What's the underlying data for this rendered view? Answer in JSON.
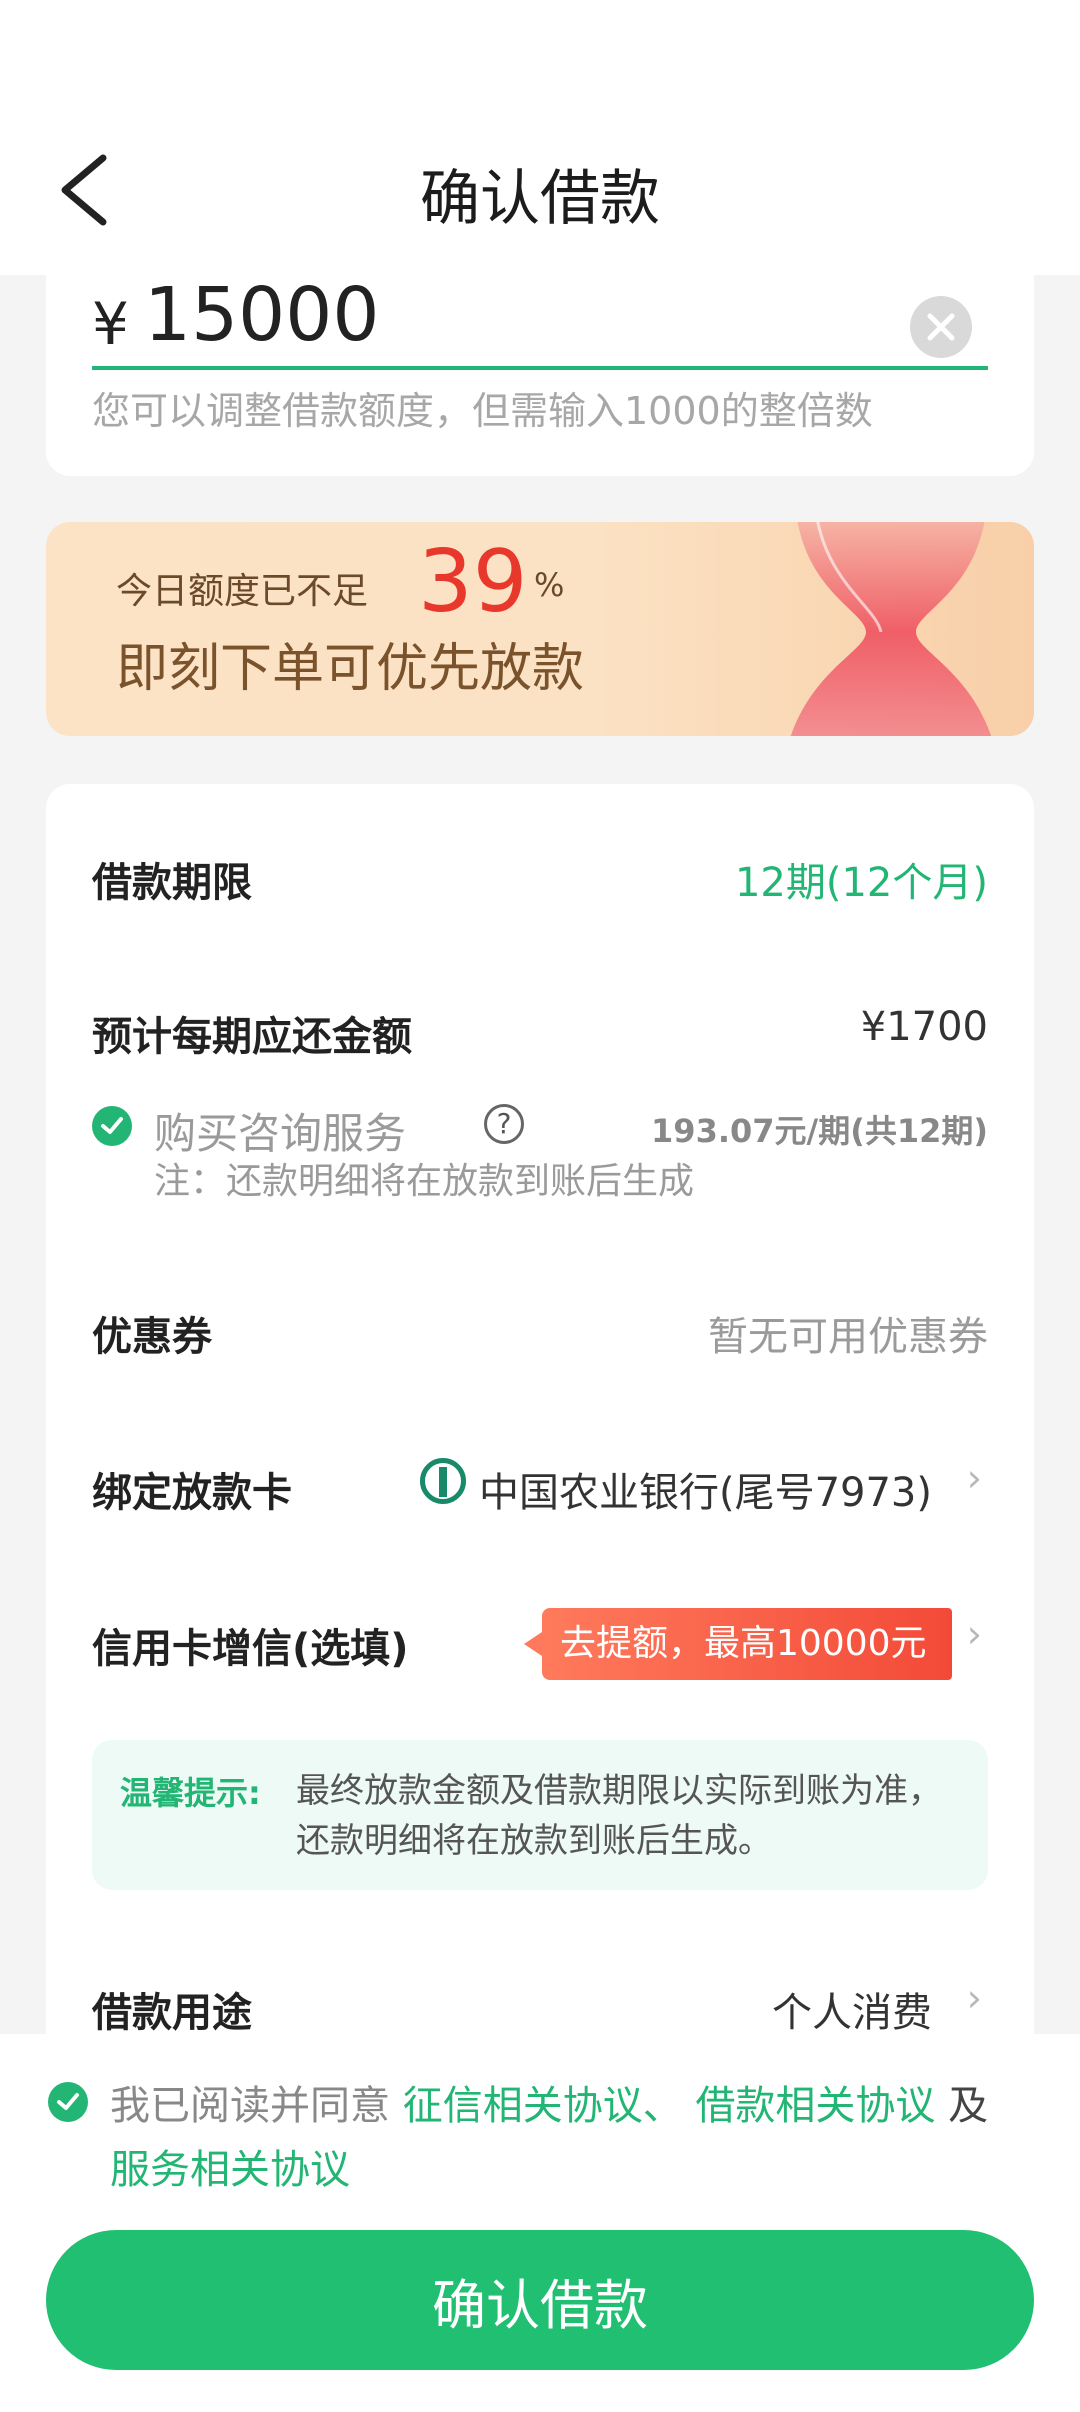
{
  "header": {
    "title": "确认借款"
  },
  "amount": {
    "currency": "¥",
    "value": "15000",
    "hint": "您可以调整借款额度，但需输入1000的整倍数"
  },
  "banner": {
    "line1": "今日额度已不足",
    "number": "39",
    "unit": "%",
    "line2": "即刻下单可优先放款"
  },
  "term": {
    "label": "借款期限",
    "value": "12期(12个月)"
  },
  "repayment": {
    "label": "预计每期应还金额",
    "value": "¥1700"
  },
  "service": {
    "label": "购买咨询服务",
    "help": "?",
    "price": "193.07元/期(共12期)",
    "note": "注：还款明细将在放款到账后生成"
  },
  "coupon": {
    "label": "优惠券",
    "value": "暂无可用优惠券"
  },
  "card": {
    "label": "绑定放款卡",
    "value": "中国农业银行(尾号7973)"
  },
  "credit_boost": {
    "label": "信用卡增信(选填)",
    "badge": "去提额，最高10000元"
  },
  "tip": {
    "label": "温馨提示:",
    "text": "最终放款金额及借款期限以实际到账为准，还款明细将在放款到账后生成。"
  },
  "purpose": {
    "label": "借款用途",
    "value": "个人消费"
  },
  "agreement": {
    "prefix": "我已阅读并同意",
    "link1": "征信相关协议、",
    "link2": "借款相关协议",
    "and": "及",
    "link3": "服务相关协议"
  },
  "confirm_button": "确认借款",
  "colors": {
    "accent": "#22b573",
    "alert": "#e8382b"
  },
  "icons": [
    "back-arrow-icon",
    "clear-icon",
    "hourglass-icon",
    "check-icon",
    "help-icon",
    "bank-logo-icon",
    "chevron-right-icon"
  ]
}
